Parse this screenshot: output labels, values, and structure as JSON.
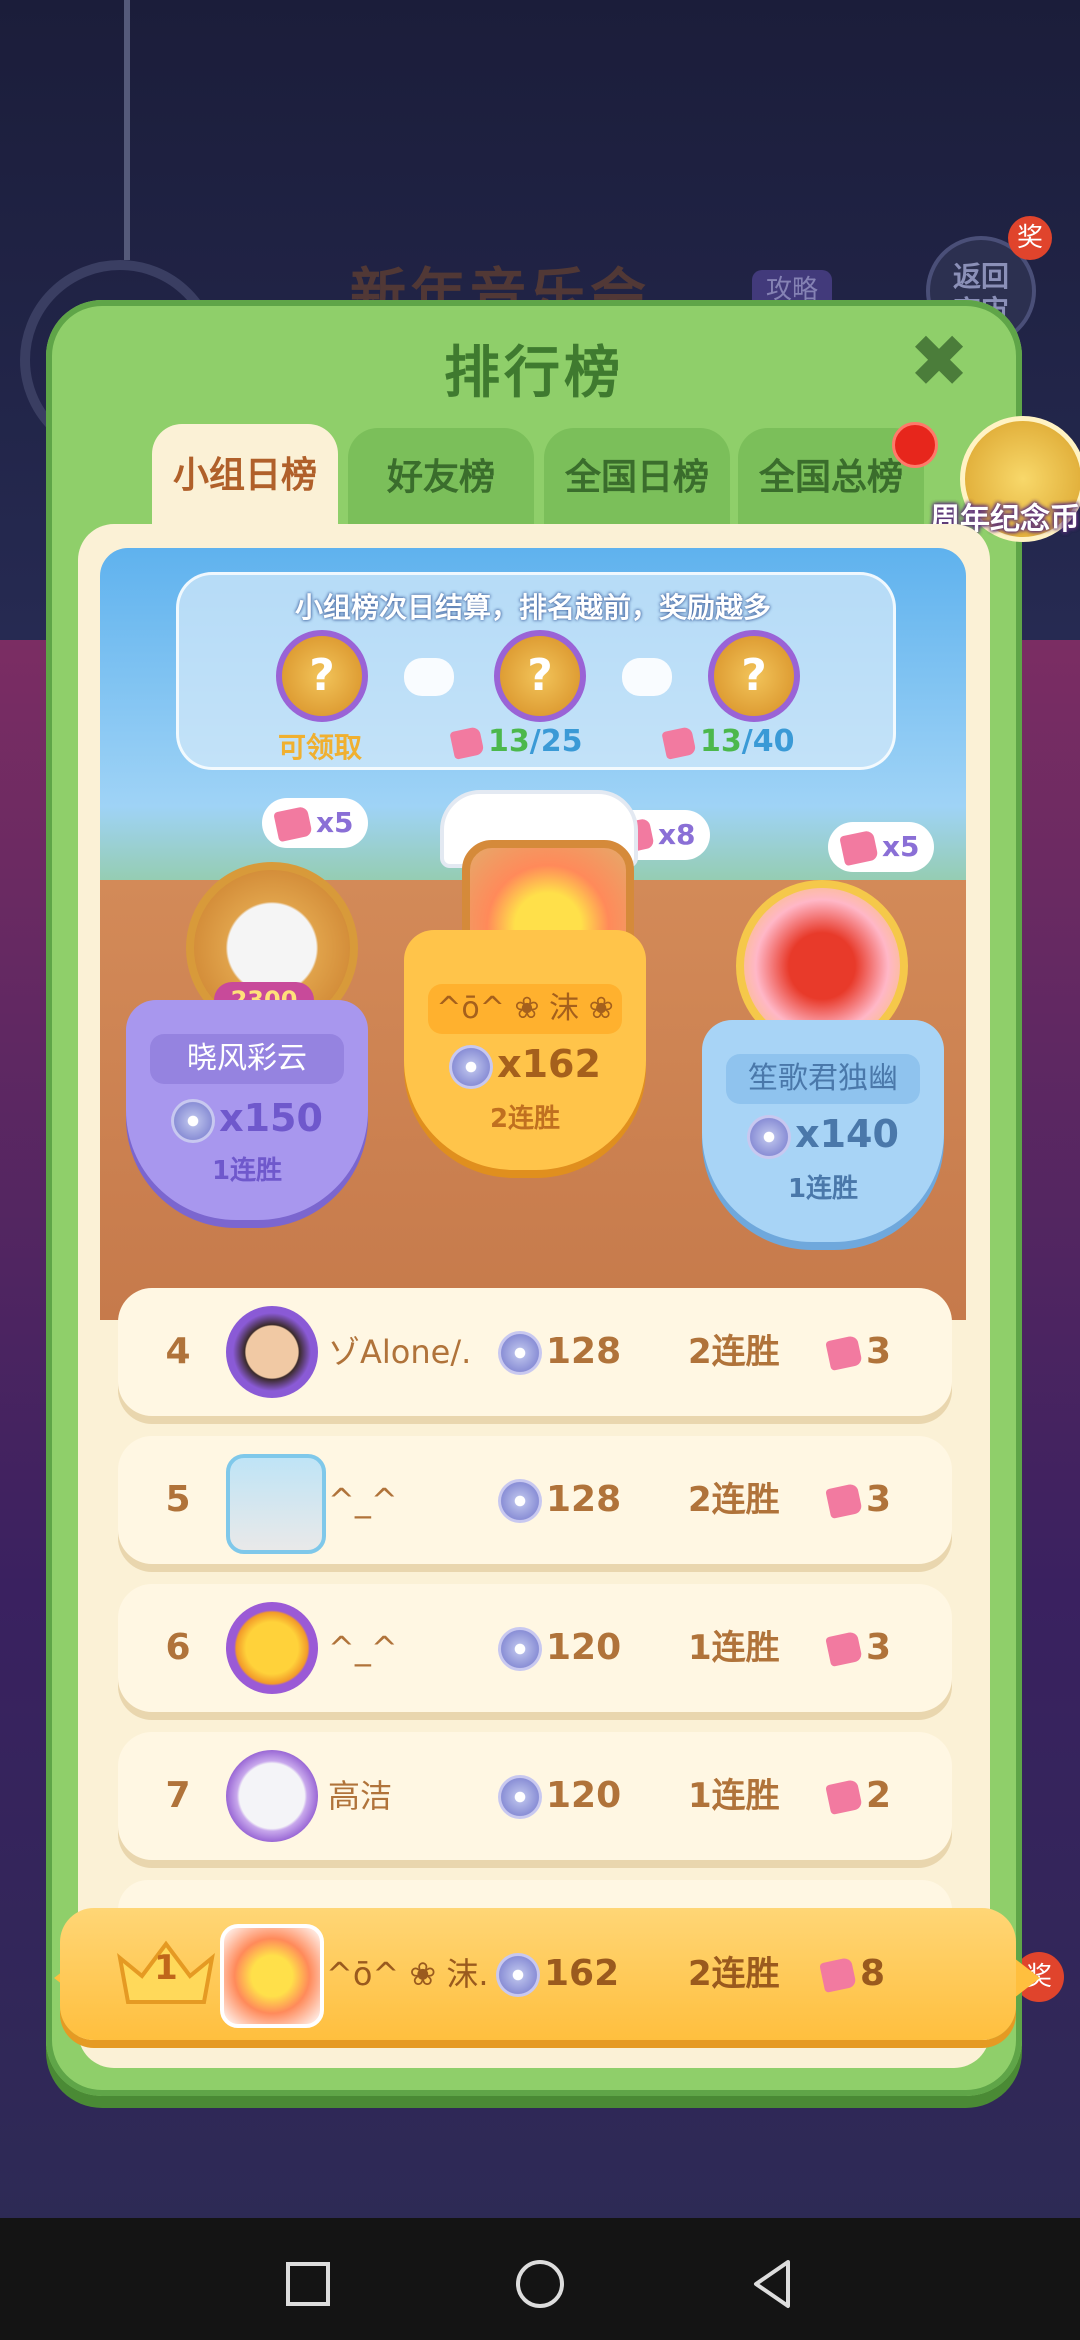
{
  "background": {
    "event_title": "新年音乐会",
    "guide_tag": "攻略",
    "back_button": "返回\n宇宙",
    "back_badge": "奖",
    "side_badge": "奖"
  },
  "panel": {
    "title": "排行榜",
    "close_label": "✖"
  },
  "tabs": [
    {
      "label": "小组日榜",
      "active": true
    },
    {
      "label": "好友榜",
      "active": false
    },
    {
      "label": "全国日榜",
      "active": false
    },
    {
      "label": "全国总榜",
      "active": false
    }
  ],
  "side_coin": {
    "label": "周年纪念币"
  },
  "rewards": {
    "info": "小组榜次日结算，排名越前，奖励越多",
    "items": [
      {
        "status": "可领取"
      },
      {
        "progress_current": "13",
        "progress_total": "/25"
      },
      {
        "progress_current": "13",
        "progress_total": "/40"
      }
    ],
    "icon_glyph": "?"
  },
  "podium": [
    {
      "place": 2,
      "name": "晓风彩云",
      "score": "x150",
      "streak": "1连胜",
      "tickets": "x5",
      "frame_label": "2300",
      "color": "#a897ee"
    },
    {
      "place": 1,
      "name": "^ō^ ❀ 沫 ❀",
      "score": "x162",
      "streak": "2连胜",
      "tickets": "x8",
      "color": "#ffc44a"
    },
    {
      "place": 3,
      "name": "笙歌君独幽",
      "score": "x140",
      "streak": "1连胜",
      "tickets": "x5",
      "color": "#a8d4f6"
    }
  ],
  "rows": [
    {
      "rank": "4",
      "name": "ゾAlone/.",
      "score": "128",
      "streak": "2连胜",
      "tickets": "3"
    },
    {
      "rank": "5",
      "name": "^_^",
      "score": "128",
      "streak": "2连胜",
      "tickets": "3"
    },
    {
      "rank": "6",
      "name": "^_^",
      "score": "120",
      "streak": "1连胜",
      "tickets": "3"
    },
    {
      "rank": "7",
      "name": "高洁",
      "score": "120",
      "streak": "1连胜",
      "tickets": "2"
    }
  ],
  "my_row": {
    "rank": "1",
    "name": "^ō^ ❀ 沫...",
    "score": "162",
    "streak": "2连胜",
    "tickets": "8"
  },
  "colors": {
    "panel_green": "#8fcf6a",
    "inner_cream": "#fbf1d6",
    "rank_text": "#b0733a",
    "highlight": "#ffc44a"
  },
  "icons": {
    "close": "close-icon",
    "disc": "disc-icon",
    "ticket": "ticket-icon",
    "crown": "crown-icon"
  }
}
